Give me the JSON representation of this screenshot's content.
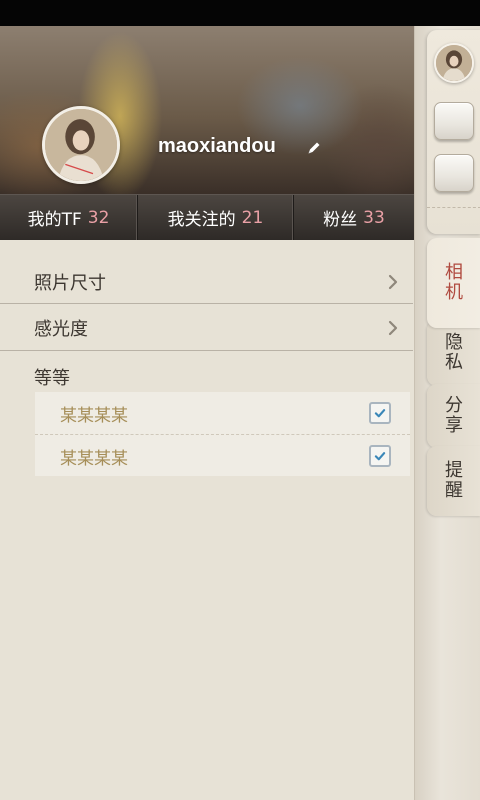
{
  "profile": {
    "username": "maoxiandou"
  },
  "stats": [
    {
      "label": "我的TF",
      "value": "32"
    },
    {
      "label": "我关注的",
      "value": "21"
    },
    {
      "label": "粉丝",
      "value": "33"
    }
  ],
  "settings": {
    "photo_size": "照片尺寸",
    "iso": "感光度",
    "section_label": "等等",
    "sub_items": [
      {
        "label": "某某某某",
        "checked": true
      },
      {
        "label": "某某某某",
        "checked": true
      }
    ]
  },
  "rail": {
    "tabs": [
      "相机",
      "隐私",
      "分享",
      "提醒"
    ],
    "active_tab": "相机"
  },
  "colors": {
    "accent_red": "#b04a3f",
    "stat_number": "#e9a0a6",
    "sub_item_text": "#a68e58",
    "checkmark": "#3a87b8"
  },
  "icons": {
    "edit": "pencil-icon",
    "row_arrow": "chevron-right-icon",
    "check": "checkmark-icon"
  }
}
